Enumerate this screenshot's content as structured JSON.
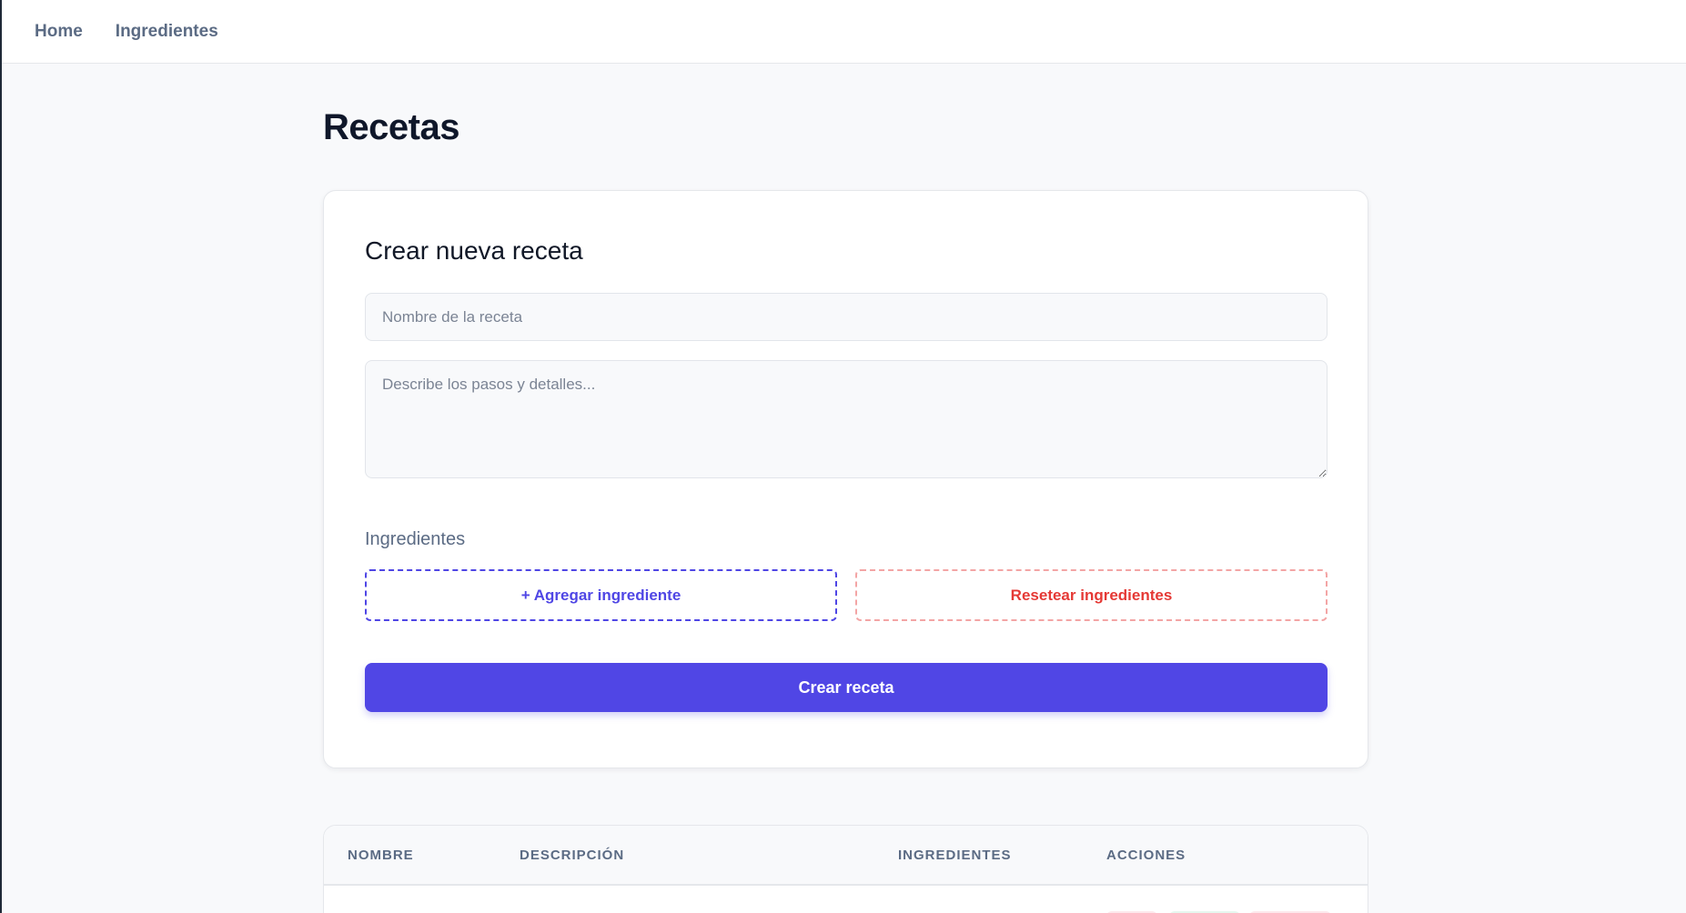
{
  "nav": {
    "items": [
      {
        "label": "Home"
      },
      {
        "label": "Ingredientes"
      }
    ]
  },
  "page": {
    "title": "Recetas"
  },
  "form": {
    "title": "Crear nueva receta",
    "name_placeholder": "Nombre de la receta",
    "name_value": "",
    "description_placeholder": "Describe los pasos y detalles...",
    "description_value": "",
    "ingredients_label": "Ingredientes",
    "add_ingredient_label": "+ Agregar ingrediente",
    "reset_ingredients_label": "Resetear ingredientes",
    "submit_label": "Crear receta"
  },
  "table": {
    "headers": [
      "NOMBRE",
      "DESCRIPCIÓN",
      "INGREDIENTES",
      "ACCIONES"
    ]
  },
  "colors": {
    "accent": "#5046e5",
    "danger": "#e53935",
    "danger_border": "#f3a5a5",
    "muted_text": "#5b6b84",
    "background": "#f8f9fb"
  }
}
